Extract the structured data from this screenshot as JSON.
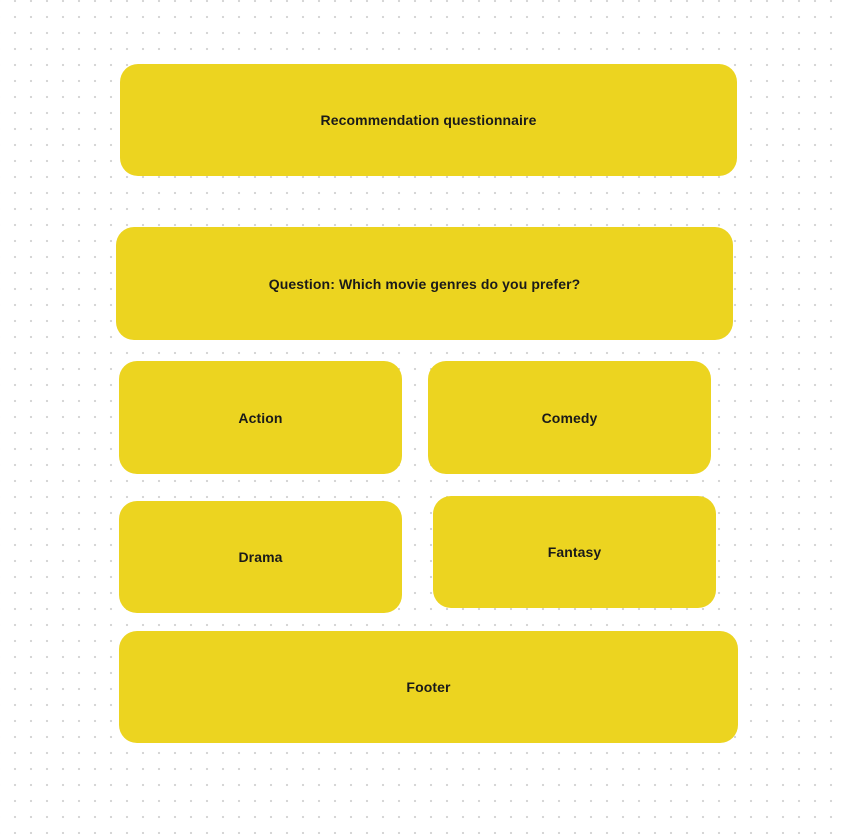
{
  "header": {
    "title": "Recommendation questionnaire"
  },
  "question": {
    "text": "Question: Which movie genres do you prefer?"
  },
  "options": [
    {
      "label": "Action"
    },
    {
      "label": "Comedy"
    },
    {
      "label": "Drama"
    },
    {
      "label": "Fantasy"
    }
  ],
  "footer": {
    "label": "Footer"
  },
  "colors": {
    "block_fill": "#ecd420",
    "text": "#1a1a1a",
    "background": "#ffffff",
    "grid_dot": "#d4d4d4"
  }
}
